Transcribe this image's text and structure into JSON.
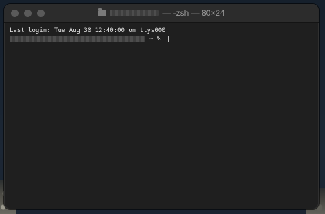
{
  "window": {
    "title_suffix": "— -zsh — 80×24",
    "traffic_lights": [
      "close",
      "minimize",
      "zoom"
    ],
    "icon": "folder-icon"
  },
  "terminal": {
    "last_login": "Last login: Tue Aug 30 12:40:00 on ttys000",
    "prompt_suffix": "~ %"
  },
  "colors": {
    "terminal_bg": "#1f1f1f",
    "titlebar_bg": "#2c2c2c",
    "text": "#e8e8e8"
  }
}
